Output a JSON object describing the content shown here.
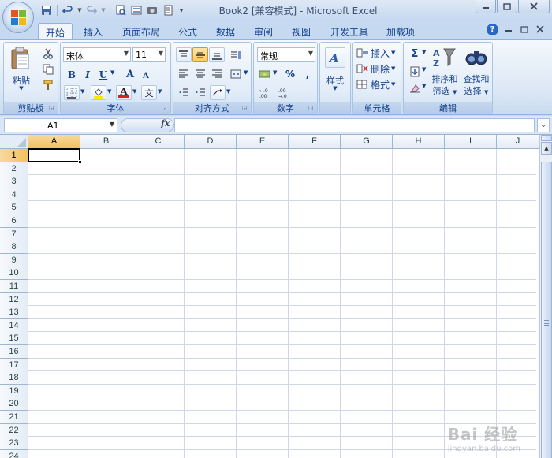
{
  "window": {
    "title": "Book2  [兼容模式] - Microsoft Excel"
  },
  "tabs": [
    {
      "label": "开始"
    },
    {
      "label": "插入"
    },
    {
      "label": "页面布局"
    },
    {
      "label": "公式"
    },
    {
      "label": "数据"
    },
    {
      "label": "审阅"
    },
    {
      "label": "视图"
    },
    {
      "label": "开发工具"
    },
    {
      "label": "加载项"
    }
  ],
  "ribbon": {
    "clipboard": {
      "group_label": "剪贴板",
      "paste_label": "粘贴"
    },
    "font": {
      "group_label": "字体",
      "font_name": "宋体",
      "font_size": "11",
      "bold": "B",
      "italic": "I",
      "underline": "U",
      "grow": "A",
      "shrink": "A",
      "font_color_glyph": "A",
      "phonetic": "文"
    },
    "alignment": {
      "group_label": "对齐方式"
    },
    "number": {
      "group_label": "数字",
      "format": "常规",
      "percent": "%",
      "comma": ",",
      "inc_decimal": "+.0 .00",
      "dec_decimal": ".00 →.0"
    },
    "styles": {
      "label": "样式"
    },
    "cells": {
      "group_label": "单元格",
      "insert": "插入",
      "delete": "删除",
      "format": "格式"
    },
    "editing": {
      "group_label": "编辑",
      "sort_filter_line1": "排序和",
      "sort_filter_line2": "筛选",
      "find_select_line1": "查找和",
      "find_select_line2": "选择",
      "sum": "Σ"
    }
  },
  "formula_bar": {
    "name_box": "A1",
    "fx": "fx",
    "formula": ""
  },
  "grid": {
    "columns": [
      "A",
      "B",
      "C",
      "D",
      "E",
      "F",
      "G",
      "H",
      "I",
      "J"
    ],
    "rows": [
      "1",
      "2",
      "3",
      "4",
      "5",
      "6",
      "7",
      "8",
      "9",
      "10",
      "11",
      "12",
      "13",
      "14",
      "15",
      "16",
      "17",
      "18",
      "19",
      "20",
      "21",
      "22",
      "23",
      "24"
    ],
    "active_cell": "A1"
  },
  "watermark": {
    "main": "Bai 经验",
    "sub": "jingyan.baidu.com"
  },
  "colors": {
    "ribbon_bg": "#dbe7f5",
    "header_selected": "#f1c15f",
    "gridline": "#d0d7e5",
    "text_blue": "#15428b"
  }
}
